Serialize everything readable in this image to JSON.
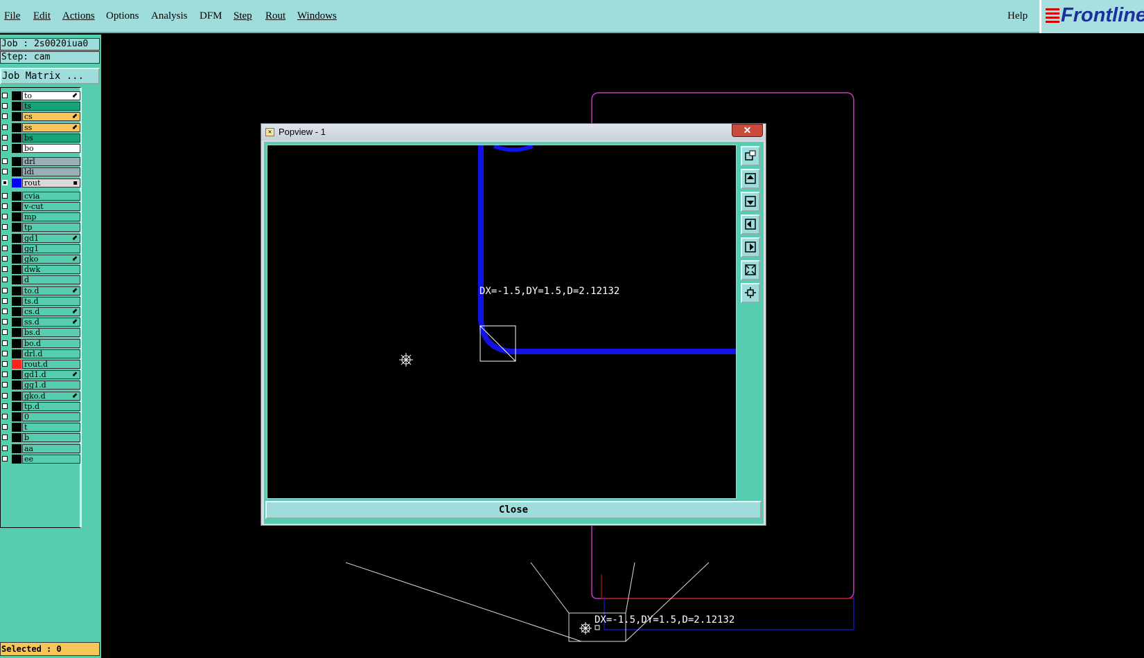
{
  "menubar": {
    "items": [
      "File",
      "Edit",
      "Actions",
      "Options",
      "Analysis",
      "DFM",
      "Step",
      "Rout",
      "Windows"
    ],
    "help": "Help",
    "logo_text": "Frontline"
  },
  "job": {
    "line": "Job : 2s0020iua0",
    "step": "Step: cam",
    "matrix_button": "Job Matrix ..."
  },
  "layers": [
    {
      "name": "to",
      "color": "#ffffff",
      "swatch": "#000000",
      "mark": "⬋",
      "selected": false
    },
    {
      "name": "ts",
      "color": "#1aa37a",
      "swatch": "#000000",
      "mark": "",
      "selected": false
    },
    {
      "name": "cs",
      "color": "#f7c65a",
      "swatch": "#000000",
      "mark": "⬋",
      "selected": false
    },
    {
      "name": "ss",
      "color": "#f7c65a",
      "swatch": "#000000",
      "mark": "⬋",
      "selected": false
    },
    {
      "name": "bs",
      "color": "#1aa37a",
      "swatch": "#000000",
      "mark": "",
      "selected": false
    },
    {
      "name": "bo",
      "color": "#ffffff",
      "swatch": "#000000",
      "mark": "",
      "selected": false
    },
    {
      "name": "drl",
      "color": "#9aaeb5",
      "swatch": "#000000",
      "mark": "",
      "selected": false
    },
    {
      "name": "ldi",
      "color": "#9aaeb5",
      "swatch": "#000000",
      "mark": "",
      "selected": false
    },
    {
      "name": "rout",
      "color": "#d9d9d9",
      "swatch": "#0000ff",
      "mark": "▪",
      "selected": true
    },
    {
      "name": "cvia",
      "color": "#56cdae",
      "swatch": "#000000",
      "mark": "",
      "selected": false
    },
    {
      "name": "v-cut",
      "color": "#56cdae",
      "swatch": "#000000",
      "mark": "",
      "selected": false
    },
    {
      "name": "mp",
      "color": "#56cdae",
      "swatch": "#000000",
      "mark": "",
      "selected": false
    },
    {
      "name": "tp",
      "color": "#56cdae",
      "swatch": "#000000",
      "mark": "",
      "selected": false
    },
    {
      "name": "gd1",
      "color": "#56cdae",
      "swatch": "#000000",
      "mark": "⬋",
      "selected": false
    },
    {
      "name": "gg1",
      "color": "#56cdae",
      "swatch": "#000000",
      "mark": "",
      "selected": false
    },
    {
      "name": "gko",
      "color": "#56cdae",
      "swatch": "#000000",
      "mark": "⬋",
      "selected": false
    },
    {
      "name": "dwk",
      "color": "#56cdae",
      "swatch": "#000000",
      "mark": "",
      "selected": false
    },
    {
      "name": "d",
      "color": "#56cdae",
      "swatch": "#000000",
      "mark": "",
      "selected": false
    },
    {
      "name": "to.d",
      "color": "#56cdae",
      "swatch": "#000000",
      "mark": "⬋",
      "selected": false
    },
    {
      "name": "ts.d",
      "color": "#56cdae",
      "swatch": "#000000",
      "mark": "",
      "selected": false
    },
    {
      "name": "cs.d",
      "color": "#56cdae",
      "swatch": "#000000",
      "mark": "⬋",
      "selected": false
    },
    {
      "name": "ss.d",
      "color": "#56cdae",
      "swatch": "#000000",
      "mark": "⬋",
      "selected": false
    },
    {
      "name": "bs.d",
      "color": "#56cdae",
      "swatch": "#000000",
      "mark": "",
      "selected": false
    },
    {
      "name": "bo.d",
      "color": "#56cdae",
      "swatch": "#000000",
      "mark": "",
      "selected": false
    },
    {
      "name": "drl.d",
      "color": "#56cdae",
      "swatch": "#000000",
      "mark": "",
      "selected": false
    },
    {
      "name": "rout.d",
      "color": "#56cdae",
      "swatch": "#ff2020",
      "mark": "",
      "selected": false
    },
    {
      "name": "gd1.d",
      "color": "#56cdae",
      "swatch": "#000000",
      "mark": "⬋",
      "selected": false
    },
    {
      "name": "gg1.d",
      "color": "#56cdae",
      "swatch": "#000000",
      "mark": "",
      "selected": false
    },
    {
      "name": "gko.d",
      "color": "#56cdae",
      "swatch": "#000000",
      "mark": "⬋",
      "selected": false
    },
    {
      "name": "tp.d",
      "color": "#56cdae",
      "swatch": "#000000",
      "mark": "",
      "selected": false
    },
    {
      "name": "0",
      "color": "#56cdae",
      "swatch": "#000000",
      "mark": "",
      "selected": false
    },
    {
      "name": "t",
      "color": "#56cdae",
      "swatch": "#000000",
      "mark": "",
      "selected": false
    },
    {
      "name": "b",
      "color": "#56cdae",
      "swatch": "#000000",
      "mark": "",
      "selected": false
    },
    {
      "name": "aa",
      "color": "#56cdae",
      "swatch": "#000000",
      "mark": "",
      "selected": false
    },
    {
      "name": "ee",
      "color": "#56cdae",
      "swatch": "#000000",
      "mark": "",
      "selected": false
    }
  ],
  "status": {
    "selected": "Selected : 0"
  },
  "canvas": {
    "measure_label": "DX=-1.5,DY=1.5,D=2.12132"
  },
  "popview": {
    "title": "Popview - 1",
    "title_close": "✕",
    "measure_label": "DX=-1.5,DY=1.5,D=2.12132",
    "close_button": "Close",
    "toolbar_icons": [
      "zoom-window-icon",
      "pan-up-icon",
      "pan-down-icon",
      "pan-left-icon",
      "pan-right-icon",
      "zoom-out-icon",
      "zoom-home-icon"
    ]
  }
}
